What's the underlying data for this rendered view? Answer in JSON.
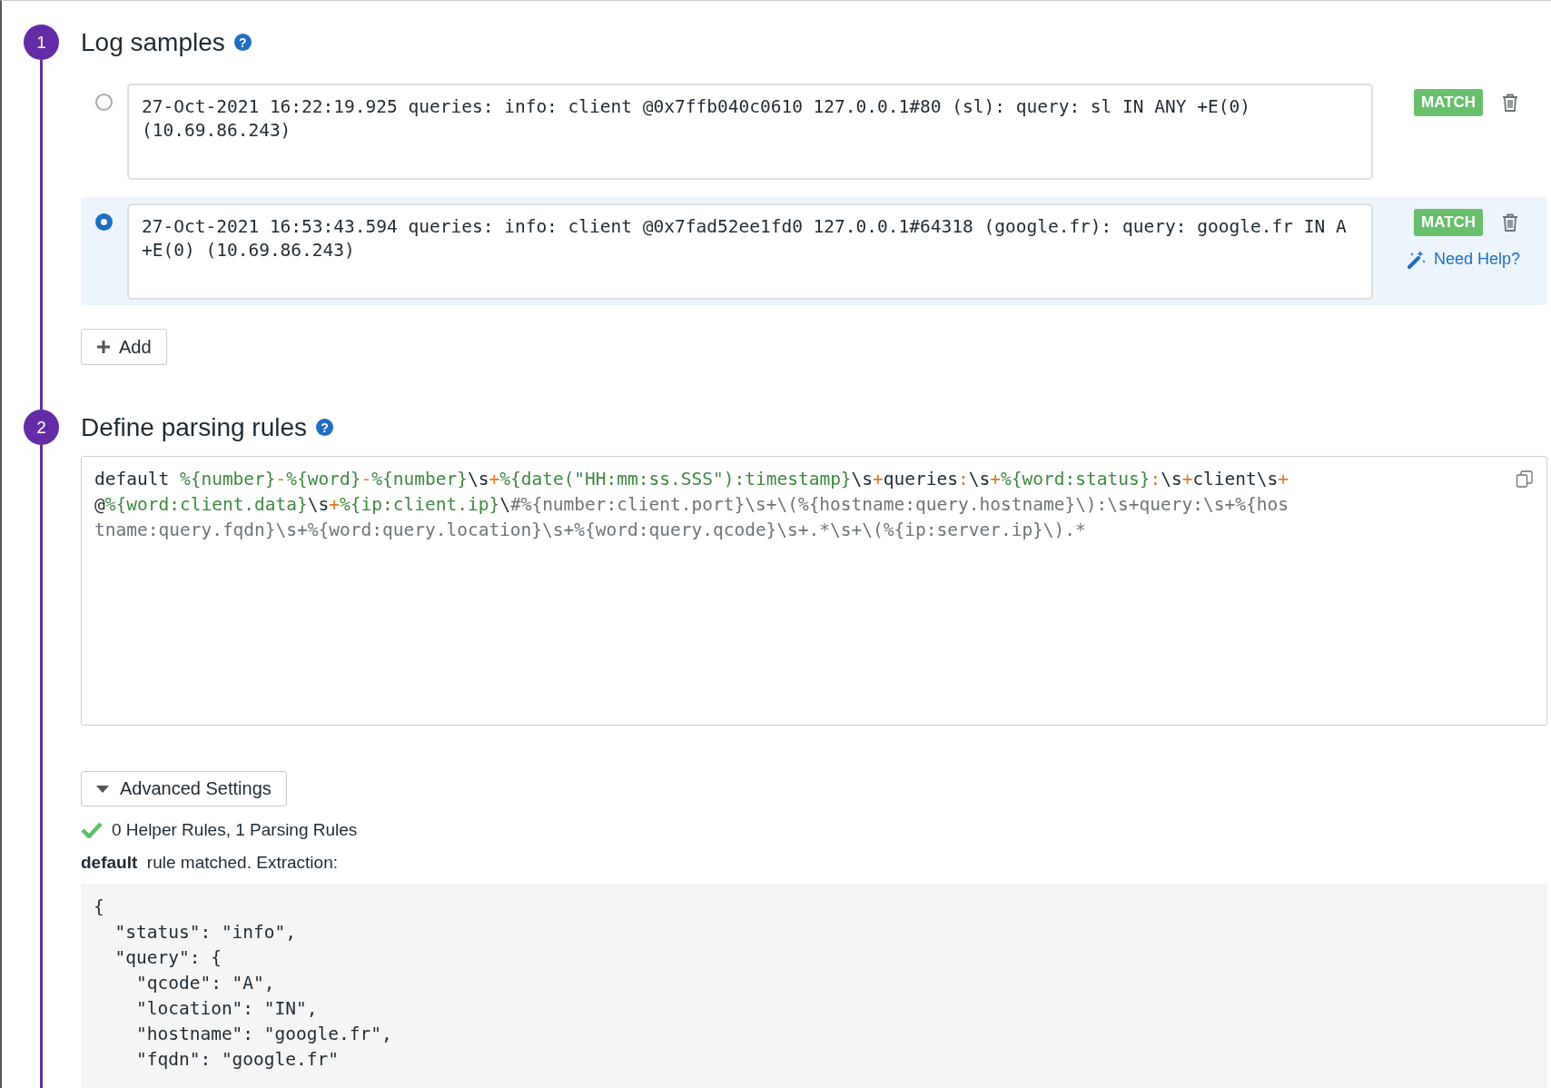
{
  "steps": [
    {
      "number": "1",
      "title": "Log samples",
      "help_icon": "?",
      "samples": [
        {
          "text": "27-Oct-2021 16:22:19.925 queries: info: client @0x7ffb040c0610 127.0.0.1#80 (sl): query: sl IN ANY +E(0) (10.69.86.243)",
          "selected": false,
          "status": "MATCH"
        },
        {
          "text": "27-Oct-2021 16:53:43.594 queries: info: client @0x7fad52ee1fd0 127.0.0.1#64318 (google.fr): query: google.fr IN A +E(0) (10.69.86.243)",
          "selected": true,
          "status": "MATCH",
          "help_link": "Need Help?"
        }
      ],
      "add_button": "Add"
    },
    {
      "number": "2",
      "title": "Define parsing rules",
      "help_icon": "?",
      "rule": [
        {
          "kind": "plain",
          "text": "default "
        },
        {
          "kind": "pattern",
          "text": "%{number}"
        },
        {
          "kind": "operator",
          "text": "-"
        },
        {
          "kind": "pattern",
          "text": "%{word}"
        },
        {
          "kind": "operator",
          "text": "-"
        },
        {
          "kind": "pattern",
          "text": "%{number}"
        },
        {
          "kind": "plain",
          "text": "\\s"
        },
        {
          "kind": "operator",
          "text": "+"
        },
        {
          "kind": "pattern",
          "text": "%{date(\"HH:mm:ss.SSS\"):timestamp}"
        },
        {
          "kind": "plain",
          "text": "\\s"
        },
        {
          "kind": "operator",
          "text": "+"
        },
        {
          "kind": "plain",
          "text": "queries"
        },
        {
          "kind": "operator",
          "text": ":"
        },
        {
          "kind": "plain",
          "text": "\\s"
        },
        {
          "kind": "operator",
          "text": "+"
        },
        {
          "kind": "pattern",
          "text": "%{word:status}"
        },
        {
          "kind": "operator",
          "text": ":"
        },
        {
          "kind": "plain",
          "text": "\\s"
        },
        {
          "kind": "operator",
          "text": "+"
        },
        {
          "kind": "plain",
          "text": "client\\s"
        },
        {
          "kind": "operator",
          "text": "+"
        },
        {
          "kind": "plain",
          "text": "@"
        },
        {
          "kind": "pattern",
          "text": "%{word:client.data}"
        },
        {
          "kind": "plain",
          "text": "\\s"
        },
        {
          "kind": "operator",
          "text": "+"
        },
        {
          "kind": "pattern",
          "text": "%{ip:client.ip}"
        },
        {
          "kind": "plain",
          "text": "\\"
        },
        {
          "kind": "unmatched",
          "text": "#%{number:client.port}\\s+\\(%{hostname:query.hostname}\\):\\s+query:\\s+%{hostname:query.fqdn}\\s+%{word:query.location}\\s+%{word:query.qcode}\\s+.*\\s+\\(%{ip:server.ip}\\).*"
        }
      ],
      "advanced_settings": "Advanced Settings",
      "summary": {
        "text": "0 Helper Rules, 1 Parsing Rules",
        "valid": true
      },
      "matched": "**default**  rule matched. Extraction:",
      "extraction": [
        "{",
        "  \"status\": \"info\",",
        "  \"query\": {",
        "    \"qcode\": \"A\",",
        "    \"location\": \"IN\",",
        "    \"hostname\": \"google.fr\",",
        "    \"fqdn\": \"google.fr\""
      ]
    }
  ]
}
